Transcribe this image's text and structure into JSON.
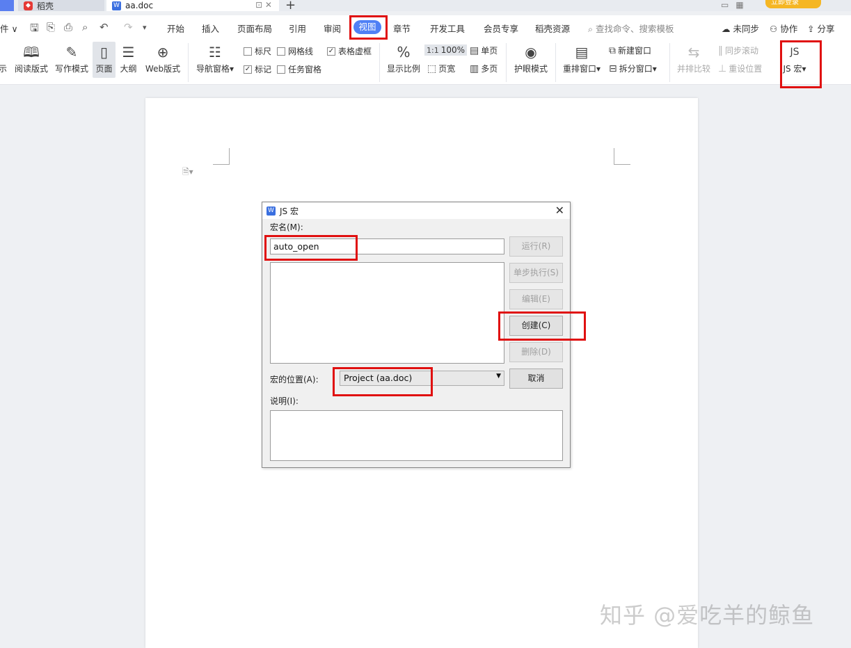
{
  "tabbar": {
    "wps_tab_label": "稻壳",
    "doc_tab_label": "aa.doc",
    "login_label": "立即登录"
  },
  "menubar": {
    "file_label": "件",
    "items": [
      "开始",
      "插入",
      "页面布局",
      "引用",
      "审阅",
      "视图",
      "章节",
      "开发工具",
      "会员专享",
      "稻壳资源"
    ],
    "active_item": "视图",
    "search_placeholder": "查找命令、搜索模板",
    "sync_label": "未同步",
    "collab_label": "协作",
    "share_label": "分享"
  },
  "ribbon": {
    "show_label": "示",
    "read_mode": "阅读版式",
    "write_mode": "写作模式",
    "page_view": "页面",
    "outline": "大纲",
    "web_layout": "Web版式",
    "nav_pane": "导航窗格",
    "ruler": "标尺",
    "gridlines": "网格线",
    "table_gridlines": "表格虚框",
    "marks": "标记",
    "task_pane": "任务窗格",
    "zoom": "显示比例",
    "zoom_100": "100%",
    "page_width": "页宽",
    "single_page": "单页",
    "multi_page": "多页",
    "eye_protect": "护眼模式",
    "arrange": "重排窗口",
    "new_window": "新建窗口",
    "split_window": "拆分窗口",
    "side_by_side": "并排比较",
    "sync_scroll": "同步滚动",
    "reset_position": "重设位置",
    "js_macro": "JS 宏"
  },
  "dialog": {
    "title": "JS 宏",
    "macro_name_label": "宏名(M):",
    "macro_name_value": "auto_open",
    "btn_run": "运行(R)",
    "btn_step": "单步执行(S)",
    "btn_edit": "编辑(E)",
    "btn_create": "创建(C)",
    "btn_delete": "删除(D)",
    "btn_cancel": "取消",
    "location_label": "宏的位置(A):",
    "location_value": "Project (aa.doc)",
    "description_label": "说明(I):"
  },
  "watermark": "知乎 @爱吃羊的鲸鱼",
  "colors": {
    "highlight": "#e01010",
    "accent": "#4f80f5"
  }
}
